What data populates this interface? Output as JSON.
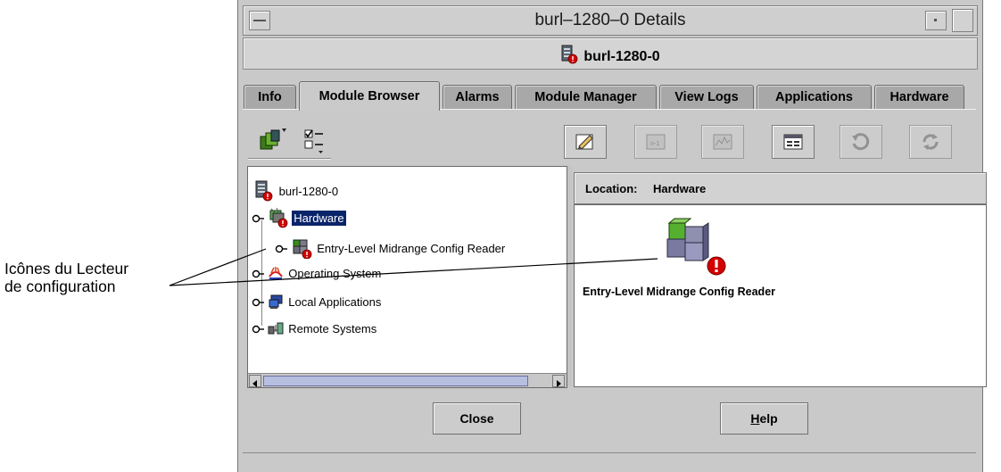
{
  "annotation": {
    "line1": "Icônes du Lecteur",
    "line2": "de configuration"
  },
  "window": {
    "title": "burl–1280–0 Details",
    "host": "burl-1280-0"
  },
  "tabs": [
    {
      "label": "Info",
      "active": false
    },
    {
      "label": "Module Browser",
      "active": true
    },
    {
      "label": "Alarms",
      "active": false
    },
    {
      "label": "Module Manager",
      "active": false
    },
    {
      "label": "View Logs",
      "active": false
    },
    {
      "label": "Applications",
      "active": false
    },
    {
      "label": "Hardware",
      "active": false
    }
  ],
  "tree": {
    "root": "burl-1280-0",
    "items": [
      {
        "label": "Hardware",
        "selected": true,
        "icon": "hardware-icon"
      },
      {
        "label": "Entry-Level Midrange Config Reader",
        "icon": "module-icon"
      },
      {
        "label": "Operating System",
        "icon": "os-icon"
      },
      {
        "label": "Local Applications",
        "icon": "local-apps-icon"
      },
      {
        "label": "Remote Systems",
        "icon": "remote-systems-icon"
      }
    ]
  },
  "location": {
    "label": "Location:",
    "value": "Hardware"
  },
  "module": {
    "label": "Entry-Level Midrange Config Reader"
  },
  "buttons": {
    "close": "Close",
    "help_mnemonic": "H",
    "help_rest": "elp"
  },
  "colors": {
    "window_bg": "#c9c9c9",
    "selection": "#0a246a",
    "alarm_red": "#d40000"
  }
}
